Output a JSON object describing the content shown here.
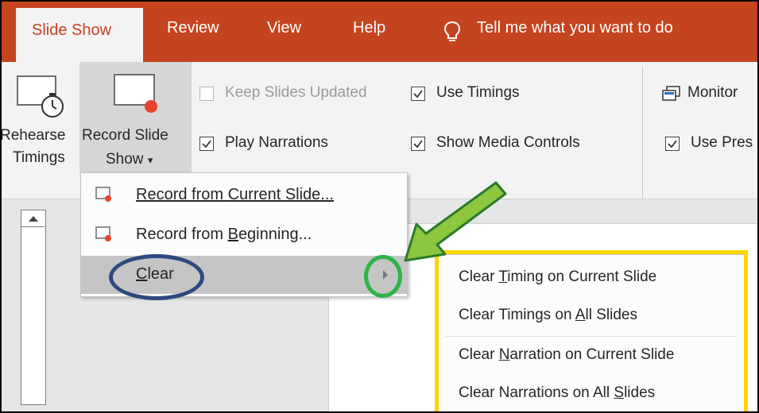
{
  "tabs": {
    "slide_show": "Slide Show",
    "review": "Review",
    "view": "View",
    "help": "Help",
    "tell_me": "Tell me what you want to do"
  },
  "ribbon": {
    "rehearse_line1": "Rehearse",
    "rehearse_line2": "Timings",
    "record_line1": "Record Slide",
    "record_line2": "Show",
    "record_caret": "▾",
    "keep_updated": "Keep Slides Updated",
    "play_narrations": "Play Narrations",
    "use_timings": "Use Timings",
    "show_media_controls": "Show Media Controls",
    "monitor": "Monitor",
    "use_presenter": "Use Pres"
  },
  "menu": {
    "items": [
      {
        "label": "Record from Current Slide..."
      },
      {
        "label_pre": "Record from ",
        "label_u": "B",
        "label_post": "eginning..."
      },
      {
        "label_u": "C",
        "label_post": "lear"
      }
    ]
  },
  "submenu": {
    "items": [
      {
        "pre": "Clear ",
        "u": "T",
        "post": "iming on Current Slide"
      },
      {
        "pre": "Clear Timings on ",
        "u": "A",
        "post": "ll Slides"
      },
      {
        "pre": "Clear ",
        "u": "N",
        "post": "arration on Current Slide"
      },
      {
        "pre": "Clear Narrations on All ",
        "u": "S",
        "post": "lides"
      }
    ]
  },
  "colors": {
    "tab_bar": "#c54420",
    "record_dot": "#e8442b",
    "highlight_yellow": "#ffd500",
    "highlight_blue": "#2b4a7e",
    "highlight_green": "#2db34a",
    "arrow_fill": "#8dc63f"
  },
  "icons": [
    "lightbulb-icon",
    "rehearse-timings-icon",
    "record-slide-show-icon",
    "monitor-icon",
    "submenu-arrow-icon",
    "scroll-up-icon"
  ]
}
